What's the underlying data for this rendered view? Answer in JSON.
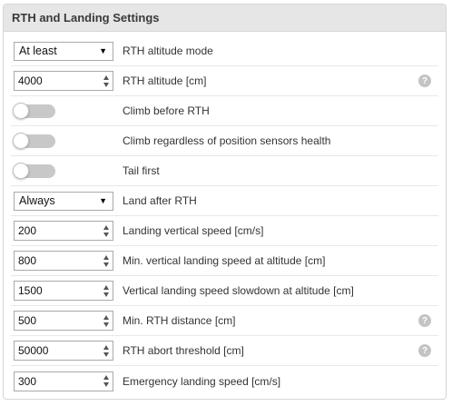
{
  "header": {
    "title": "RTH and Landing Settings"
  },
  "rows": [
    {
      "type": "select",
      "value": "At least",
      "label": "RTH altitude mode",
      "help": false
    },
    {
      "type": "number",
      "value": "4000",
      "label": "RTH altitude [cm]",
      "help": true
    },
    {
      "type": "toggle",
      "on": false,
      "label": "Climb before RTH",
      "help": false
    },
    {
      "type": "toggle",
      "on": false,
      "label": "Climb regardless of position sensors health",
      "help": false
    },
    {
      "type": "toggle",
      "on": false,
      "label": "Tail first",
      "help": false
    },
    {
      "type": "select",
      "value": "Always",
      "label": "Land after RTH",
      "help": false
    },
    {
      "type": "number",
      "value": "200",
      "label": "Landing vertical speed [cm/s]",
      "help": false
    },
    {
      "type": "number",
      "value": "800",
      "label": "Min. vertical landing speed at altitude [cm]",
      "help": false
    },
    {
      "type": "number",
      "value": "1500",
      "label": "Vertical landing speed slowdown at altitude [cm]",
      "help": false
    },
    {
      "type": "number",
      "value": "500",
      "label": "Min. RTH distance [cm]",
      "help": true
    },
    {
      "type": "number",
      "value": "50000",
      "label": "RTH abort threshold [cm]",
      "help": true
    },
    {
      "type": "number",
      "value": "300",
      "label": "Emergency landing speed [cm/s]",
      "help": false
    }
  ],
  "icons": {
    "help": "question-mark-icon",
    "select_arrow": "caret-down-icon",
    "spinner": "spinner-arrows-icon"
  },
  "help_glyph": "?",
  "select_glyph": "▼"
}
